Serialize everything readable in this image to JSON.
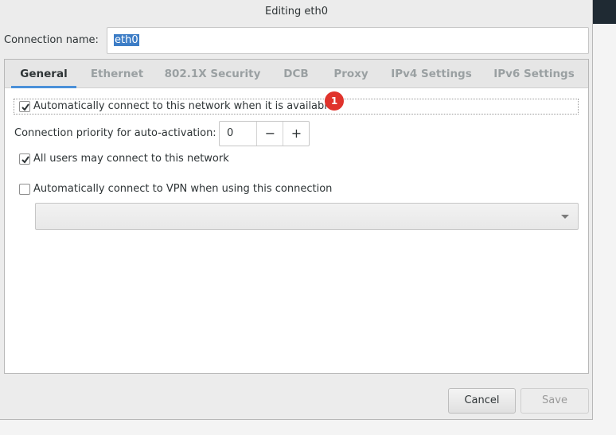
{
  "window": {
    "title": "Editing eth0"
  },
  "connection": {
    "label": "Connection name:",
    "value": "eth0"
  },
  "tabs": [
    {
      "label": "General",
      "active": true
    },
    {
      "label": "Ethernet",
      "active": false
    },
    {
      "label": "802.1X Security",
      "active": false
    },
    {
      "label": "DCB",
      "active": false
    },
    {
      "label": "Proxy",
      "active": false
    },
    {
      "label": "IPv4 Settings",
      "active": false
    },
    {
      "label": "IPv6 Settings",
      "active": false
    }
  ],
  "general": {
    "auto_connect": {
      "label": "Automatically connect to this network when it is available",
      "checked": true
    },
    "badge": "1",
    "priority": {
      "label": "Connection priority for auto-activation:",
      "value": "0",
      "minus": "−",
      "plus": "+"
    },
    "all_users": {
      "label": "All users may connect to this network",
      "checked": true
    },
    "auto_vpn": {
      "label": "Automatically connect to VPN when using this connection",
      "checked": false
    },
    "vpn_select": {
      "selected": ""
    }
  },
  "buttons": {
    "cancel": "Cancel",
    "save": "Save"
  },
  "colors": {
    "accent": "#4a90d9",
    "badge": "#e0332c",
    "selection": "#3d7dc6"
  }
}
